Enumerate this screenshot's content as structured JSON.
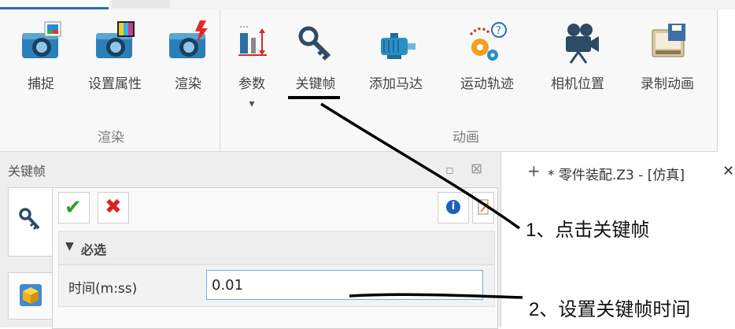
{
  "ribbon": {
    "groups": [
      {
        "label": "渲染",
        "buttons": [
          {
            "label": "捕捉",
            "icon": "camera-photo-icon"
          },
          {
            "label": "设置属性",
            "icon": "camera-settings-icon"
          },
          {
            "label": "渲染",
            "icon": "camera-render-icon"
          }
        ]
      },
      {
        "label": "动画",
        "buttons": [
          {
            "label": "参数",
            "icon": "parameters-icon",
            "dropdown": "▾"
          },
          {
            "label": "关键帧",
            "icon": "key-icon"
          },
          {
            "label": "添加马达",
            "icon": "motor-icon"
          },
          {
            "label": "运动轨迹",
            "icon": "motion-path-icon"
          },
          {
            "label": "相机位置",
            "icon": "movie-camera-icon"
          },
          {
            "label": "录制动画",
            "icon": "record-animation-icon"
          }
        ]
      }
    ]
  },
  "panel": {
    "title": "关键帧",
    "pin_glyph": "▫",
    "close_glyph": "⊠",
    "ok_glyph": "✔",
    "cancel_glyph": "✖",
    "info_glyph": "i",
    "section": {
      "toggle": "▼",
      "label": "必选"
    },
    "field": {
      "label": "时间(m:ss)",
      "value": "0.01"
    }
  },
  "document_tab": {
    "add": "+",
    "label": "* 零件装配.Z3 - [仿真]",
    "close": "✕"
  },
  "annotations": [
    {
      "text": "1、点击关键帧"
    },
    {
      "text": "2、设置关键帧时间"
    }
  ],
  "colors": {
    "accent": "#1e6fd0",
    "ok": "#2e9e2e",
    "cancel": "#d8261f",
    "info": "#1f5fbf"
  }
}
